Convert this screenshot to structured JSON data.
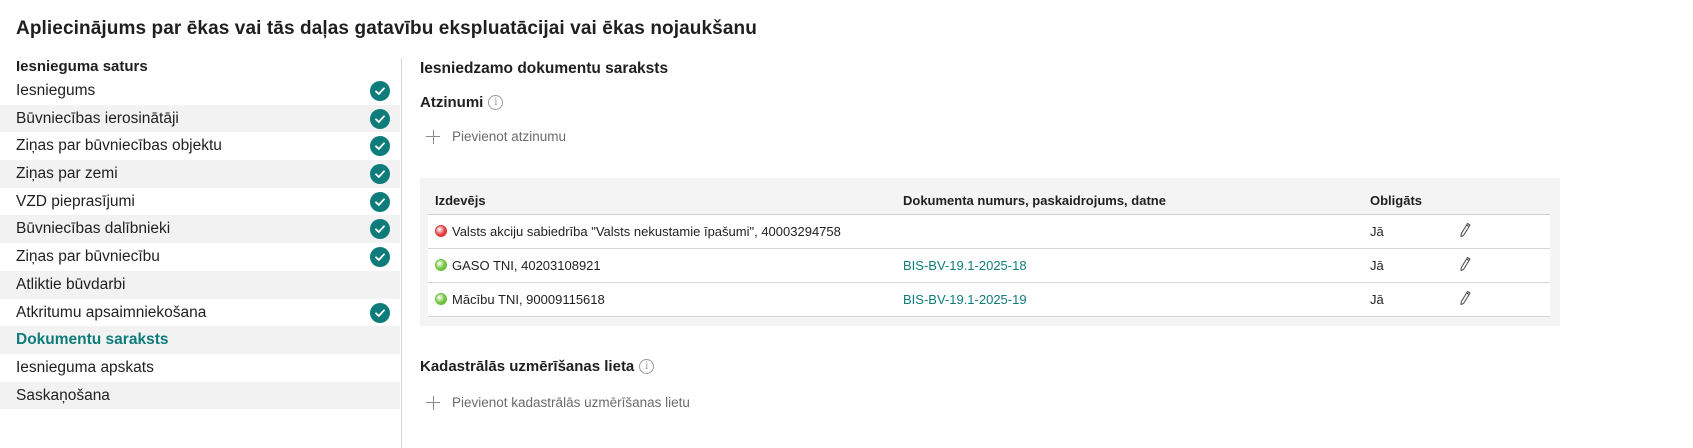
{
  "page": {
    "title": "Apliecinājums par ēkas vai tās daļas gatavību ekspluatācijai vai ēkas nojaukšanu"
  },
  "sidebar": {
    "heading": "Iesnieguma saturs",
    "items": [
      {
        "label": "Iesniegums",
        "completed": true
      },
      {
        "label": "Būvniecības ierosinātāji",
        "completed": true
      },
      {
        "label": "Ziņas par būvniecības objektu",
        "completed": true
      },
      {
        "label": "Ziņas par zemi",
        "completed": true
      },
      {
        "label": "VZD pieprasījumi",
        "completed": true
      },
      {
        "label": "Būvniecības dalībnieki",
        "completed": true
      },
      {
        "label": "Ziņas par būvniecību",
        "completed": true
      },
      {
        "label": "Atliktie būvdarbi",
        "completed": false
      },
      {
        "label": "Atkritumu apsaimniekošana",
        "completed": true
      },
      {
        "label": "Dokumentu saraksts",
        "completed": false,
        "active": true
      },
      {
        "label": "Iesnieguma apskats",
        "completed": false
      },
      {
        "label": "Saskaņošana",
        "completed": false
      }
    ]
  },
  "main": {
    "title": "Iesniedzamo dokumentu saraksts",
    "opinions": {
      "title": "Atzinumi",
      "add_label": "Pievienot atzinumu",
      "columns": [
        "Izdevējs",
        "Dokumenta numurs, paskaidrojums, datne",
        "Obligāts"
      ],
      "rows": [
        {
          "issuer": "Valsts akciju sabiedrība \"Valsts nekustamie īpašumi\", 40003294758",
          "status_color": "#e03a3a",
          "document": "",
          "mandatory": "Jā"
        },
        {
          "issuer": "GASO TNI, 40203108921",
          "status_color": "#6dc23b",
          "document": "BIS-BV-19.1-2025-18",
          "mandatory": "Jā"
        },
        {
          "issuer": "Mācību TNI, 90009115618",
          "status_color": "#6dc23b",
          "document": "BIS-BV-19.1-2025-19",
          "mandatory": "Jā"
        }
      ]
    },
    "cadastral": {
      "title": "Kadastrālās uzmērīšanas lieta",
      "add_label": "Pievienot kadastrālās uzmērīšanas lietu"
    }
  },
  "colors": {
    "accent": "#0e7c7b",
    "status_red": "#e03a3a",
    "status_green": "#6dc23b"
  }
}
